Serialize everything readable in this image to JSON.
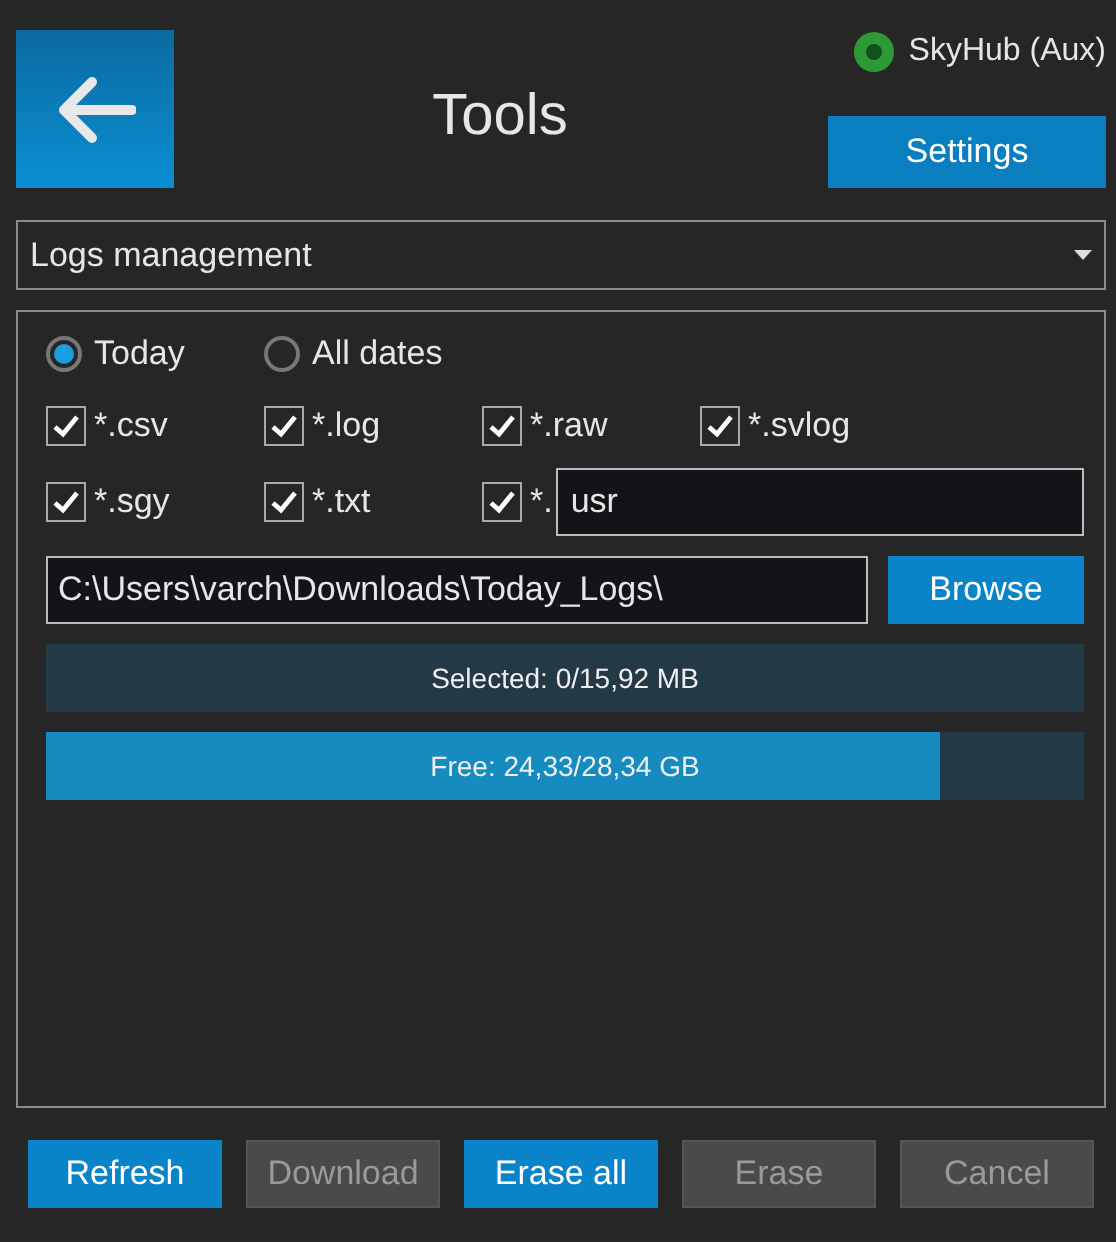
{
  "header": {
    "title": "Tools",
    "device": {
      "name": "SkyHub (Aux)",
      "connected": true
    },
    "settings_button": "Settings"
  },
  "mode_dropdown": {
    "value": "Logs management"
  },
  "date_filter": [
    {
      "label": "Today",
      "selected": true
    },
    {
      "label": "All dates",
      "selected": false
    }
  ],
  "extensions": [
    {
      "kind": "fixed",
      "label": "*.csv",
      "checked": true
    },
    {
      "kind": "fixed",
      "label": "*.log",
      "checked": true
    },
    {
      "kind": "fixed",
      "label": "*.raw",
      "checked": true
    },
    {
      "kind": "fixed",
      "label": "*.svlog",
      "checked": true
    },
    {
      "kind": "fixed",
      "label": "*.sgy",
      "checked": true
    },
    {
      "kind": "fixed",
      "label": "*.txt",
      "checked": true
    },
    {
      "kind": "custom",
      "label": "*.",
      "value": "usr",
      "checked": true
    }
  ],
  "path": {
    "value": "C:\\Users\\varch\\Downloads\\Today_Logs\\",
    "button": "Browse"
  },
  "meters": [
    {
      "label": "Selected: 0/15,92 MB",
      "level": 0
    },
    {
      "label": "Free: 24,33/28,34 GB",
      "level": 0.862
    }
  ],
  "buttons": [
    {
      "label": "Refresh",
      "disabled": false
    },
    {
      "label": "Download",
      "disabled": true
    },
    {
      "label": "Erase all",
      "disabled": false
    },
    {
      "label": "Erase",
      "disabled": true
    },
    {
      "label": "Cancel",
      "disabled": true
    }
  ]
}
